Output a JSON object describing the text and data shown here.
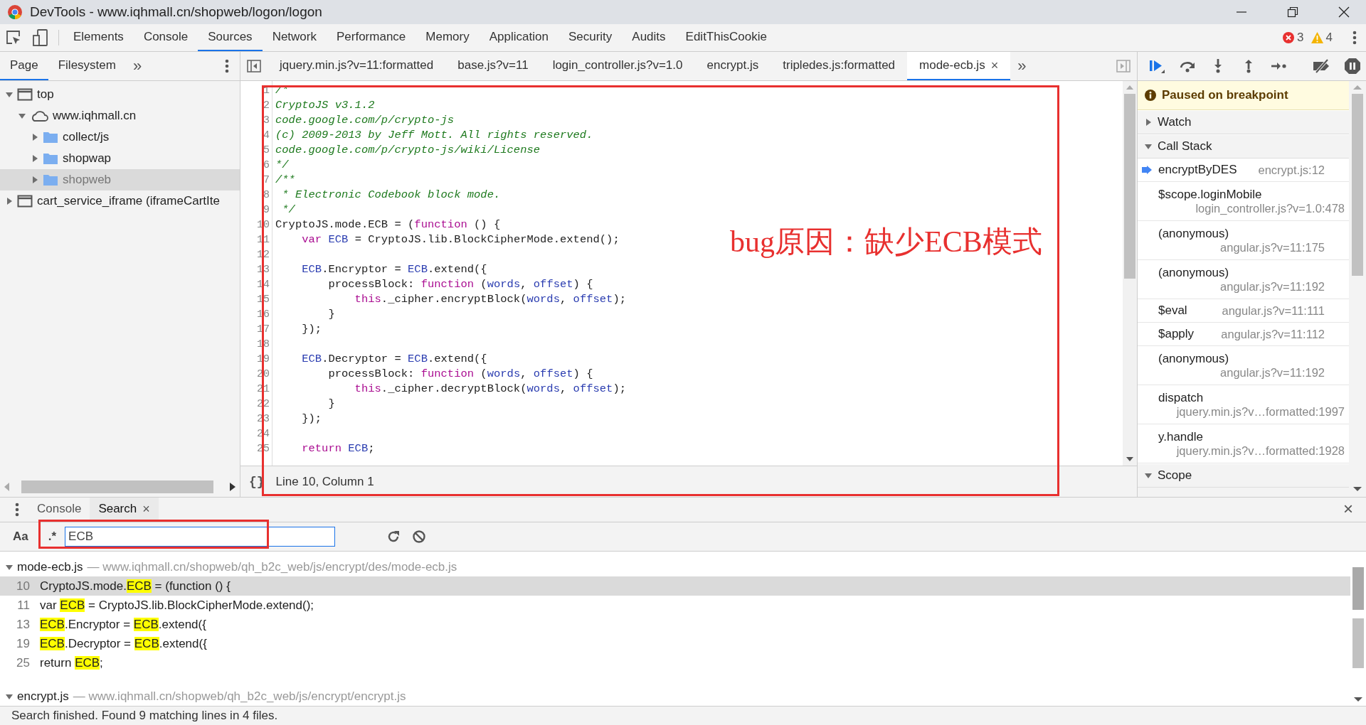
{
  "window": {
    "title": "DevTools - www.iqhmall.cn/shopweb/logon/logon"
  },
  "main_tabs": [
    {
      "label": "Elements",
      "selected": false
    },
    {
      "label": "Console",
      "selected": false
    },
    {
      "label": "Sources",
      "selected": true
    },
    {
      "label": "Network",
      "selected": false
    },
    {
      "label": "Performance",
      "selected": false
    },
    {
      "label": "Memory",
      "selected": false
    },
    {
      "label": "Application",
      "selected": false
    },
    {
      "label": "Security",
      "selected": false
    },
    {
      "label": "Audits",
      "selected": false
    },
    {
      "label": "EditThisCookie",
      "selected": false
    }
  ],
  "issues": {
    "errors": "3",
    "warnings": "4"
  },
  "navigator": {
    "tabs": [
      {
        "label": "Page",
        "selected": true
      },
      {
        "label": "Filesystem",
        "selected": false
      }
    ],
    "more": "»",
    "tree": [
      {
        "label": "top",
        "kind": "frame",
        "expanded": true,
        "selected": false,
        "children": [
          {
            "label": "www.iqhmall.cn",
            "kind": "domain",
            "expanded": true,
            "selected": false,
            "children": [
              {
                "label": "collect/js",
                "kind": "folder",
                "expanded": false,
                "selected": false
              },
              {
                "label": "shopwap",
                "kind": "folder",
                "expanded": false,
                "selected": false
              },
              {
                "label": "shopweb",
                "kind": "folder",
                "expanded": false,
                "selected": true
              }
            ]
          }
        ]
      },
      {
        "label": "cart_service_iframe (iframeCartIte",
        "kind": "frame",
        "expanded": false,
        "selected": false
      }
    ]
  },
  "editor": {
    "tabs": [
      {
        "label": "jquery.min.js?v=11:formatted",
        "selected": false
      },
      {
        "label": "base.js?v=11",
        "selected": false
      },
      {
        "label": "login_controller.js?v=1.0",
        "selected": false
      },
      {
        "label": "encrypt.js",
        "selected": false
      },
      {
        "label": "tripledes.js:formatted",
        "selected": false
      },
      {
        "label": "mode-ecb.js",
        "selected": true,
        "close": "×"
      }
    ],
    "more": "»",
    "lines": [
      {
        "number": "1",
        "tokens": [
          {
            "kind": "comment",
            "text": "/*"
          }
        ]
      },
      {
        "number": "2",
        "tokens": [
          {
            "kind": "comment",
            "text": "CryptoJS v3.1.2"
          }
        ]
      },
      {
        "number": "3",
        "tokens": [
          {
            "kind": "comment",
            "text": "code.google.com/p/crypto-js"
          }
        ]
      },
      {
        "number": "4",
        "tokens": [
          {
            "kind": "comment",
            "text": "(c) 2009-2013 by Jeff Mott. All rights reserved."
          }
        ]
      },
      {
        "number": "5",
        "tokens": [
          {
            "kind": "comment",
            "text": "code.google.com/p/crypto-js/wiki/License"
          }
        ]
      },
      {
        "number": "6",
        "tokens": [
          {
            "kind": "comment",
            "text": "*/"
          }
        ]
      },
      {
        "number": "7",
        "tokens": [
          {
            "kind": "comment",
            "text": "/**"
          }
        ]
      },
      {
        "number": "8",
        "tokens": [
          {
            "kind": "comment",
            "text": " * Electronic Codebook block mode."
          }
        ]
      },
      {
        "number": "9",
        "tokens": [
          {
            "kind": "comment",
            "text": " */"
          }
        ]
      },
      {
        "number": "10",
        "tokens": [
          {
            "kind": "plain",
            "text": "CryptoJS.mode.ECB = ("
          },
          {
            "kind": "keyword",
            "text": "function"
          },
          {
            "kind": "plain",
            "text": " () {"
          }
        ]
      },
      {
        "number": "11",
        "tokens": [
          {
            "kind": "keyword",
            "text": "    var"
          },
          {
            "kind": "variable",
            "text": " ECB"
          },
          {
            "kind": "plain",
            "text": " = CryptoJS.lib.BlockCipherMode.extend();"
          }
        ]
      },
      {
        "number": "12"
      },
      {
        "number": "13",
        "tokens": [
          {
            "kind": "variable",
            "text": "    ECB"
          },
          {
            "kind": "plain",
            "text": ".Encryptor = "
          },
          {
            "kind": "variable",
            "text": "ECB"
          },
          {
            "kind": "plain",
            "text": ".extend({"
          }
        ]
      },
      {
        "number": "14",
        "tokens": [
          {
            "kind": "plain",
            "text": "        processBlock: "
          },
          {
            "kind": "keyword",
            "text": "function"
          },
          {
            "kind": "plain",
            "text": " ("
          },
          {
            "kind": "variable",
            "text": "words"
          },
          {
            "kind": "plain",
            "text": ", "
          },
          {
            "kind": "variable",
            "text": "offset"
          },
          {
            "kind": "plain",
            "text": ") {"
          }
        ]
      },
      {
        "number": "15",
        "tokens": [
          {
            "kind": "keyword",
            "text": "            this"
          },
          {
            "kind": "plain",
            "text": "._cipher.encryptBlock("
          },
          {
            "kind": "variable",
            "text": "words"
          },
          {
            "kind": "plain",
            "text": ", "
          },
          {
            "kind": "variable",
            "text": "offset"
          },
          {
            "kind": "plain",
            "text": ");"
          }
        ]
      },
      {
        "number": "16",
        "tokens": [
          {
            "kind": "plain",
            "text": "        }"
          }
        ]
      },
      {
        "number": "17",
        "tokens": [
          {
            "kind": "plain",
            "text": "    });"
          }
        ]
      },
      {
        "number": "18"
      },
      {
        "number": "19",
        "tokens": [
          {
            "kind": "variable",
            "text": "    ECB"
          },
          {
            "kind": "plain",
            "text": ".Decryptor = "
          },
          {
            "kind": "variable",
            "text": "ECB"
          },
          {
            "kind": "plain",
            "text": ".extend({"
          }
        ]
      },
      {
        "number": "20",
        "tokens": [
          {
            "kind": "plain",
            "text": "        processBlock: "
          },
          {
            "kind": "keyword",
            "text": "function"
          },
          {
            "kind": "plain",
            "text": " ("
          },
          {
            "kind": "variable",
            "text": "words"
          },
          {
            "kind": "plain",
            "text": ", "
          },
          {
            "kind": "variable",
            "text": "offset"
          },
          {
            "kind": "plain",
            "text": ") {"
          }
        ]
      },
      {
        "number": "21",
        "tokens": [
          {
            "kind": "keyword",
            "text": "            this"
          },
          {
            "kind": "plain",
            "text": "._cipher.decryptBlock("
          },
          {
            "kind": "variable",
            "text": "words"
          },
          {
            "kind": "plain",
            "text": ", "
          },
          {
            "kind": "variable",
            "text": "offset"
          },
          {
            "kind": "plain",
            "text": ");"
          }
        ]
      },
      {
        "number": "22",
        "tokens": [
          {
            "kind": "plain",
            "text": "        }"
          }
        ]
      },
      {
        "number": "23",
        "tokens": [
          {
            "kind": "plain",
            "text": "    });"
          }
        ]
      },
      {
        "number": "24"
      },
      {
        "number": "25",
        "tokens": [
          {
            "kind": "keyword",
            "text": "    return"
          },
          {
            "kind": "variable",
            "text": " ECB"
          },
          {
            "kind": "plain",
            "text": ";"
          }
        ]
      }
    ],
    "format_label": "{}",
    "status": "Line 10, Column 1"
  },
  "annotation": {
    "text": "bug原因：缺少ECB模式"
  },
  "debugger": {
    "paused_message": "Paused on breakpoint",
    "watch": {
      "title": "Watch",
      "expanded": false
    },
    "call_stack": {
      "title": "Call Stack",
      "expanded": true,
      "frames": [
        {
          "function": "encryptByDES",
          "location": "encrypt.js:12",
          "kind": "inline",
          "selected": true
        },
        {
          "function": "$scope.loginMobile",
          "location": "login_controller.js?v=1.0:478",
          "kind": "stacked",
          "selected": false
        },
        {
          "function": "(anonymous)",
          "location": "angular.js?v=11:175",
          "kind": "stacked",
          "selected": false
        },
        {
          "function": "(anonymous)",
          "location": "angular.js?v=11:192",
          "kind": "stacked",
          "selected": false
        },
        {
          "function": "$eval",
          "location": "angular.js?v=11:111",
          "kind": "inline",
          "selected": false
        },
        {
          "function": "$apply",
          "location": "angular.js?v=11:112",
          "kind": "inline",
          "selected": false
        },
        {
          "function": "(anonymous)",
          "location": "angular.js?v=11:192",
          "kind": "stacked",
          "selected": false
        },
        {
          "function": "dispatch",
          "location": "jquery.min.js?v…formatted:1997",
          "kind": "stacked",
          "selected": false
        },
        {
          "function": "y.handle",
          "location": "jquery.min.js?v…formatted:1928",
          "kind": "stacked",
          "selected": false
        }
      ]
    },
    "scope": {
      "title": "Scope",
      "expanded": true
    }
  },
  "drawer": {
    "tabs": [
      {
        "label": "Console",
        "selected": false
      },
      {
        "label": "Search",
        "selected": true,
        "close": "×"
      }
    ],
    "close": "×",
    "search": {
      "case_label": "Aa",
      "regex_label": ".*",
      "value": "ECB"
    },
    "results": [
      {
        "file": "mode-ecb.js",
        "separator": "—",
        "path": "www.iqhmall.cn/shopweb/qh_b2c_web/js/encrypt/des/mode-ecb.js",
        "expanded": true,
        "matches": [
          {
            "line": "10",
            "selected": true,
            "segments": [
              {
                "text": "CryptoJS.mode.",
                "match": false
              },
              {
                "text": "ECB",
                "match": true
              },
              {
                "text": " = (function () {",
                "match": false
              }
            ]
          },
          {
            "line": "11",
            "selected": false,
            "segments": [
              {
                "text": "var ",
                "match": false
              },
              {
                "text": "ECB",
                "match": true
              },
              {
                "text": " = CryptoJS.lib.BlockCipherMode.extend();",
                "match": false
              }
            ]
          },
          {
            "line": "13",
            "selected": false,
            "segments": [
              {
                "text": "ECB",
                "match": true
              },
              {
                "text": ".Encryptor = ",
                "match": false
              },
              {
                "text": "ECB",
                "match": true
              },
              {
                "text": ".extend({",
                "match": false
              }
            ]
          },
          {
            "line": "19",
            "selected": false,
            "segments": [
              {
                "text": "ECB",
                "match": true
              },
              {
                "text": ".Decryptor = ",
                "match": false
              },
              {
                "text": "ECB",
                "match": true
              },
              {
                "text": ".extend({",
                "match": false
              }
            ]
          },
          {
            "line": "25",
            "selected": false,
            "segments": [
              {
                "text": "return ",
                "match": false
              },
              {
                "text": "ECB",
                "match": true
              },
              {
                "text": ";",
                "match": false
              }
            ]
          }
        ]
      },
      {
        "file": "encrypt.js",
        "separator": "—",
        "path": "www.iqhmall.cn/shopweb/qh_b2c_web/js/encrypt/encrypt.js",
        "expanded": true
      }
    ],
    "status": "Search finished.  Found 9 matching lines in 4 files."
  }
}
